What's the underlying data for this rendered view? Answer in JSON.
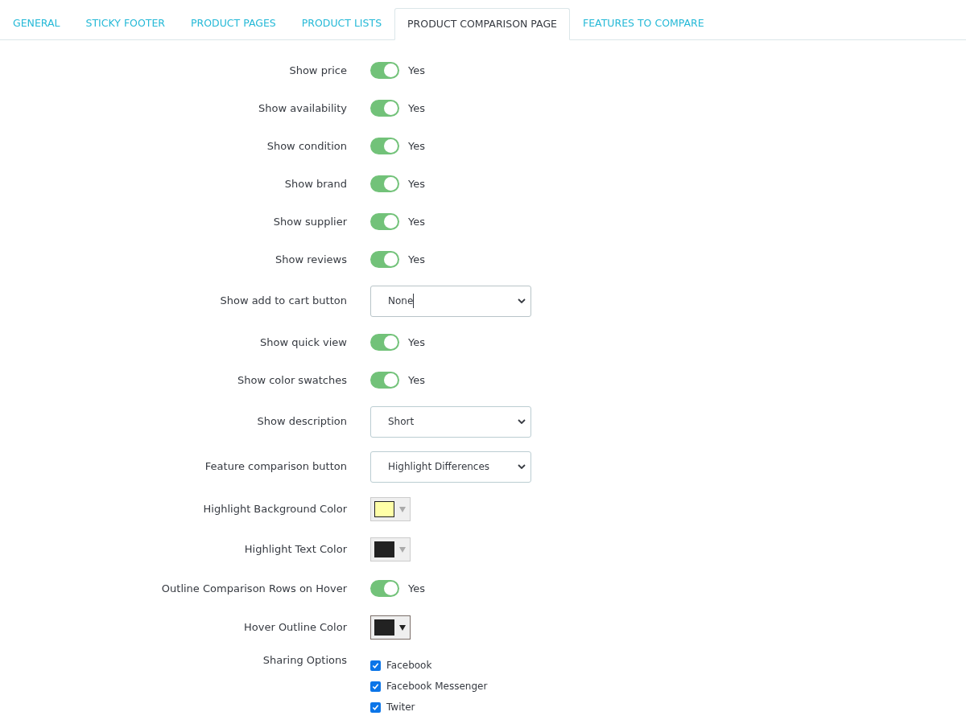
{
  "tabs": [
    {
      "label": "GENERAL",
      "selected": false
    },
    {
      "label": "STICKY FOOTER",
      "selected": false
    },
    {
      "label": "PRODUCT PAGES",
      "selected": false
    },
    {
      "label": "PRODUCT LISTS",
      "selected": false
    },
    {
      "label": "PRODUCT COMPARISON PAGE",
      "selected": true
    },
    {
      "label": "FEATURES TO COMPARE",
      "selected": false
    }
  ],
  "settings": [
    {
      "kind": "toggle",
      "label": "Show price",
      "on": true,
      "value": "Yes"
    },
    {
      "kind": "toggle",
      "label": "Show availability",
      "on": true,
      "value": "Yes"
    },
    {
      "kind": "toggle",
      "label": "Show condition",
      "on": true,
      "value": "Yes"
    },
    {
      "kind": "toggle",
      "label": "Show brand",
      "on": true,
      "value": "Yes"
    },
    {
      "kind": "toggle",
      "label": "Show supplier",
      "on": true,
      "value": "Yes"
    },
    {
      "kind": "toggle",
      "label": "Show reviews",
      "on": true,
      "value": "Yes"
    },
    {
      "kind": "select",
      "label": "Show add to cart button",
      "value": "None",
      "focused": true
    },
    {
      "kind": "toggle",
      "label": "Show quick view",
      "on": true,
      "value": "Yes"
    },
    {
      "kind": "toggle",
      "label": "Show color swatches",
      "on": true,
      "value": "Yes"
    },
    {
      "kind": "select",
      "label": "Show description",
      "value": "Short",
      "focused": false
    },
    {
      "kind": "select",
      "label": "Feature comparison button",
      "value": "Highlight Differences",
      "focused": false
    },
    {
      "kind": "color",
      "label": "Highlight Background Color",
      "color": "#ffffa8",
      "disabled": true
    },
    {
      "kind": "color",
      "label": "Highlight Text Color",
      "color": "#222222",
      "disabled": true
    },
    {
      "kind": "toggle",
      "label": "Outline Comparison Rows on Hover",
      "on": true,
      "value": "Yes"
    },
    {
      "kind": "color",
      "label": "Hover Outline Color",
      "color": "#222222",
      "disabled": false
    },
    {
      "kind": "checkboxes",
      "label": "Sharing Options",
      "options": [
        {
          "label": "Facebook",
          "checked": true
        },
        {
          "label": "Facebook Messenger",
          "checked": true
        },
        {
          "label": "Twiter",
          "checked": true
        }
      ]
    }
  ]
}
